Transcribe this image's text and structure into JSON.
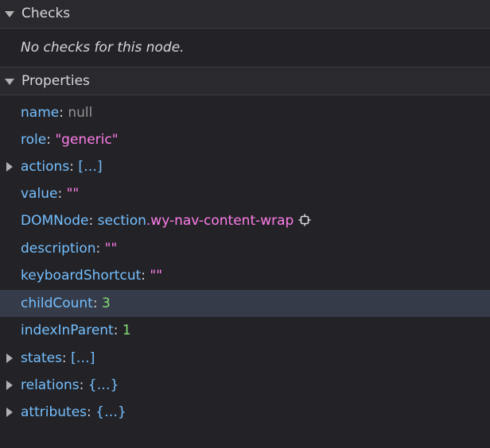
{
  "checks": {
    "title": "Checks",
    "empty_message": "No checks for this node."
  },
  "properties": {
    "title": "Properties",
    "rows": [
      {
        "key": "name",
        "value": "null",
        "type": "null"
      },
      {
        "key": "role",
        "value": "\"generic\"",
        "type": "string"
      },
      {
        "key": "actions",
        "value": "[…]",
        "type": "obj"
      },
      {
        "key": "value",
        "value": "\"\"",
        "type": "string"
      },
      {
        "key": "DOMNode",
        "tag": "section",
        "class": ".wy-nav-content-wrap",
        "icon": "select-node-icon"
      },
      {
        "key": "description",
        "value": "\"\"",
        "type": "string"
      },
      {
        "key": "keyboardShortcut",
        "value": "\"\"",
        "type": "string"
      },
      {
        "key": "childCount",
        "value": "3",
        "type": "number"
      },
      {
        "key": "indexInParent",
        "value": "1",
        "type": "number"
      },
      {
        "key": "states",
        "value": "[…]",
        "type": "obj"
      },
      {
        "key": "relations",
        "value": "{…}",
        "type": "obj"
      },
      {
        "key": "attributes",
        "value": "{…}",
        "type": "obj"
      }
    ]
  },
  "colors": {
    "background": "#232327",
    "header_background": "#2a2a2e",
    "selected_row": "#353b48",
    "key": "#75bfff",
    "string": "#ff7de9",
    "number": "#86de74",
    "null": "#939395"
  }
}
